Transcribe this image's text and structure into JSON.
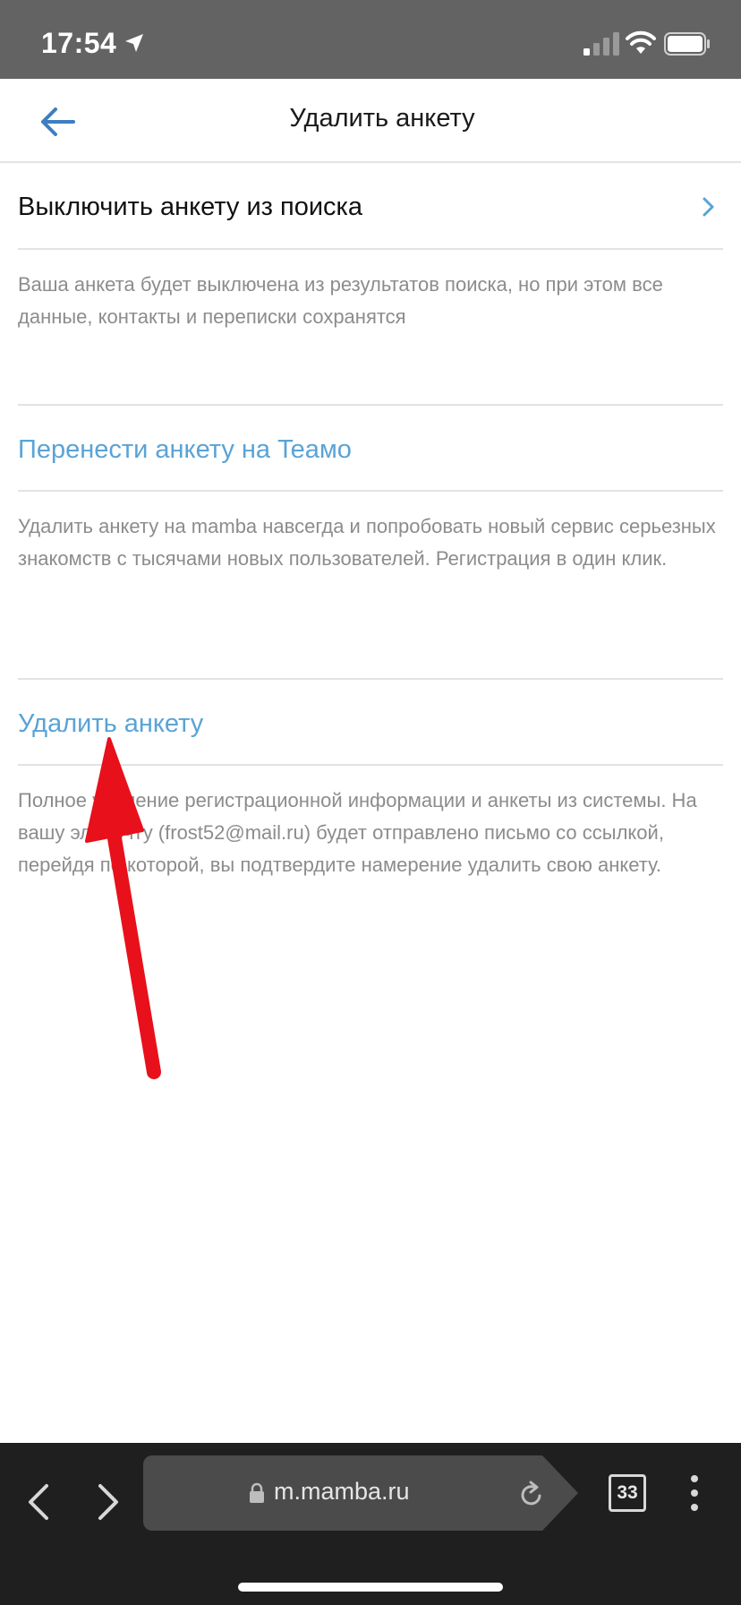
{
  "status_bar": {
    "time": "17:54",
    "icons": [
      "location-arrow-icon",
      "cellular-signal-icon",
      "wifi-icon",
      "battery-icon"
    ]
  },
  "header": {
    "back_icon": "arrow-left-icon",
    "title": "Удалить анкету"
  },
  "sections": [
    {
      "title": "Выключить анкету из поиска",
      "description": "Ваша анкета будет выключена из результатов поиска, но при этом все данные, контакты и переписки сохранятся"
    },
    {
      "title": "Перенести анкету на Teaмo",
      "description": "Удалить анкету на mamba навсегда и попробовать новый сервис серьезных знакомств с тысячами новых пользователей. Регистрация в один клик."
    },
    {
      "title": "Удалить анкету",
      "description": "Полное удаление регистрационной информации и анкеты из системы. На вашу эл. почту (frost52@mail.ru) будет отправлено письмо со ссылкой, перейдя по которой, вы подтвердите намерение удалить свою анкету."
    }
  ],
  "browser": {
    "url": "m.mamba.ru",
    "tab_count": "33",
    "icons": [
      "chevron-left-icon",
      "chevron-right-icon",
      "lock-icon",
      "reload-icon",
      "more-vertical-icon"
    ]
  },
  "colors": {
    "status_bar": "#636363",
    "link": "#5aa3d6",
    "back_arrow": "#3d7ebf",
    "description_text": "#8c8c8c",
    "browser_bar": "#1f1f1f",
    "annotation_arrow": "#e8101a"
  }
}
